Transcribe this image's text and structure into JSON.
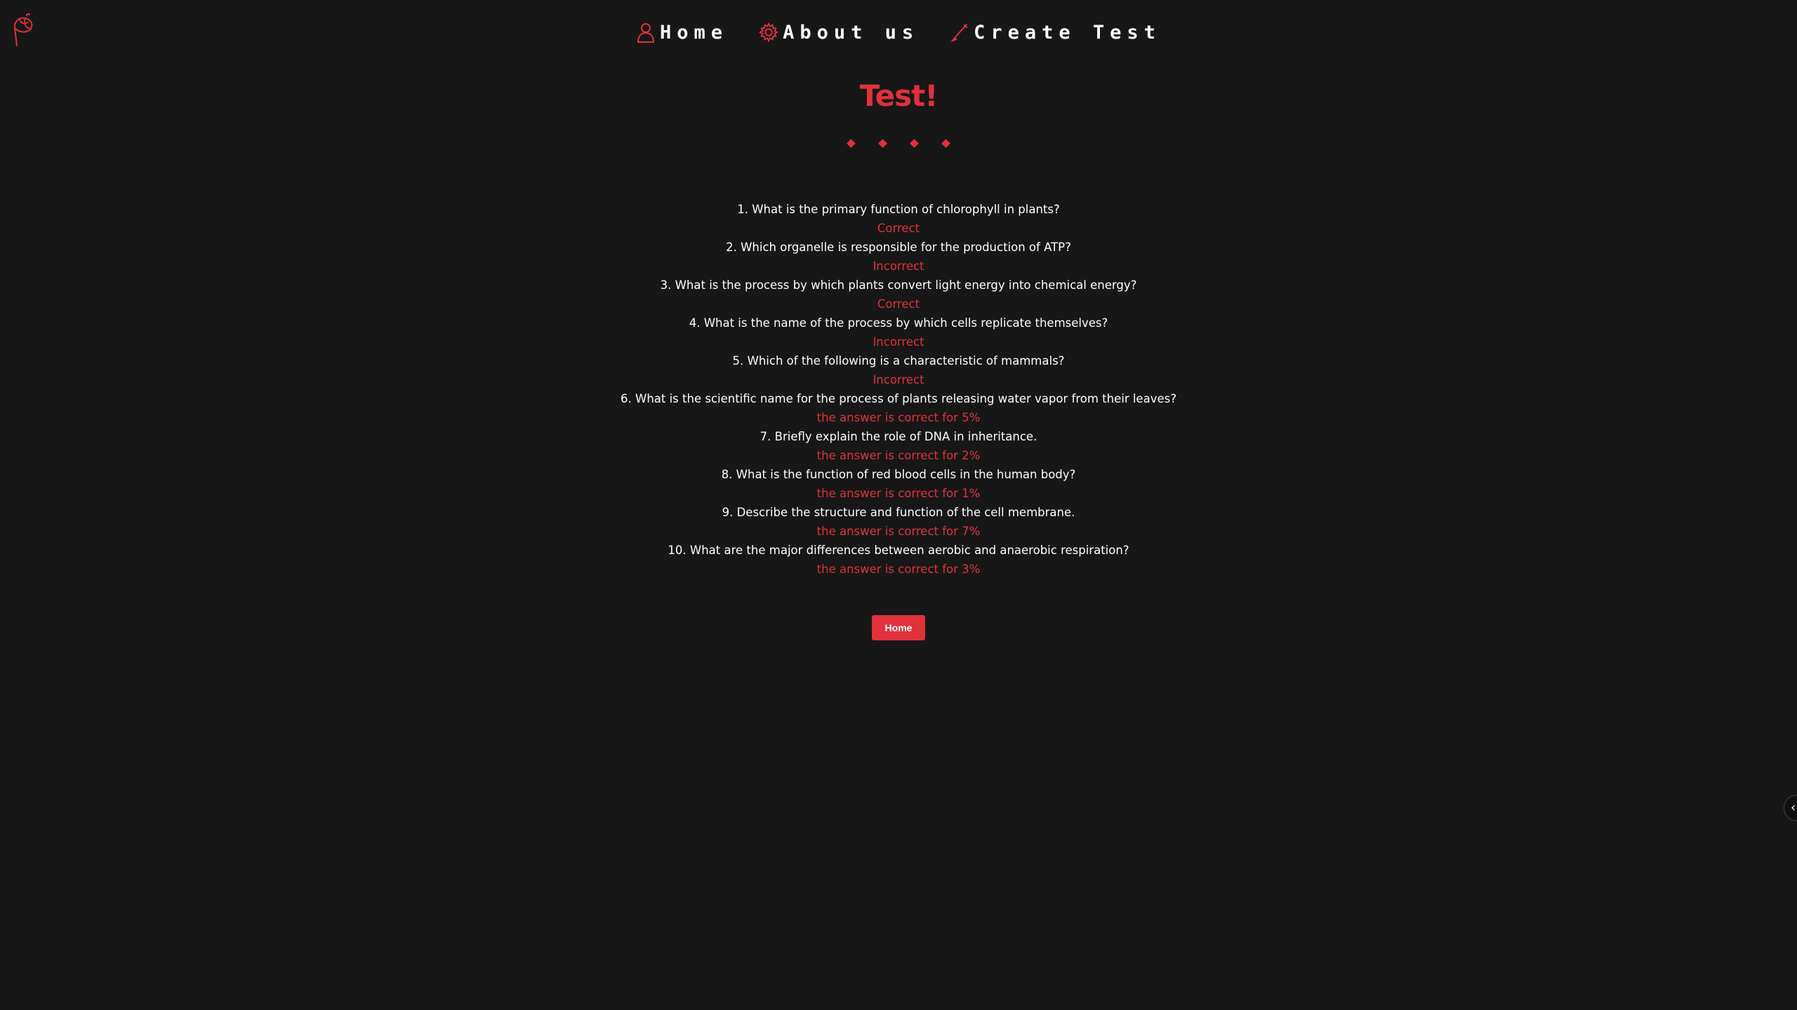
{
  "brand": {
    "logo_icon": "flower-bud-logo-icon"
  },
  "nav": {
    "items": [
      {
        "label": "Home",
        "icon": "user-icon"
      },
      {
        "label": "About us",
        "icon": "gear-icon"
      },
      {
        "label": "Create Test",
        "icon": "pen-icon"
      }
    ]
  },
  "page": {
    "title": "Test!"
  },
  "results": [
    {
      "question": "1. What is the primary function of chlorophyll in plants?",
      "verdict": "Correct"
    },
    {
      "question": "2. Which organelle is responsible for the production of ATP?",
      "verdict": "Incorrect"
    },
    {
      "question": "3. What is the process by which plants convert light energy into chemical energy?",
      "verdict": "Correct"
    },
    {
      "question": "4. What is the name of the process by which cells replicate themselves?",
      "verdict": "Incorrect"
    },
    {
      "question": "5. Which of the following is a characteristic of mammals?",
      "verdict": "Incorrect"
    },
    {
      "question": "6. What is the scientific name for the process of plants releasing water vapor from their leaves?",
      "verdict": "the answer is correct for 5%"
    },
    {
      "question": "7. Briefly explain the role of DNA in inheritance.",
      "verdict": "the answer is correct for 2%"
    },
    {
      "question": "8. What is the function of red blood cells in the human body?",
      "verdict": "the answer is correct for 1%"
    },
    {
      "question": "9. Describe the structure and function of the cell membrane.",
      "verdict": "the answer is correct for 7%"
    },
    {
      "question": "10. What are the major differences between aerobic and anaerobic respiration?",
      "verdict": "the answer is correct for 3%"
    }
  ],
  "actions": {
    "home_button": "Home"
  },
  "side_handle": {
    "icon": "chevron-left-icon",
    "glyph": "‹"
  },
  "colors": {
    "accent": "#e0313c",
    "background": "#171717",
    "text": "#ffffff"
  }
}
